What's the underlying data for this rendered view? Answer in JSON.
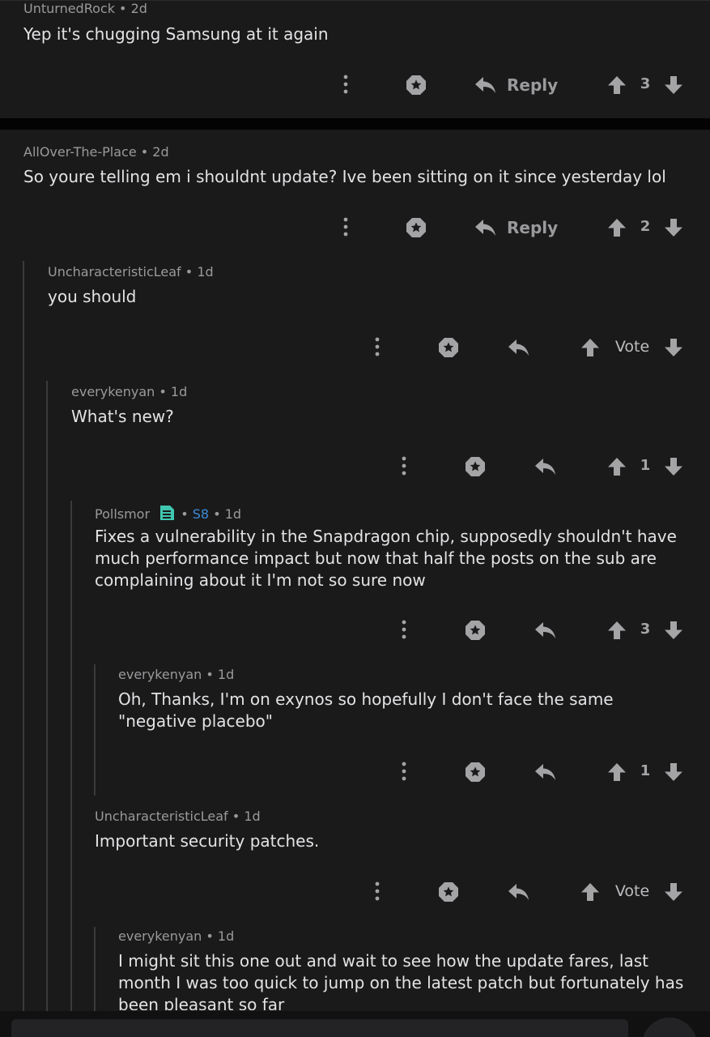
{
  "colors": {
    "background": "#1a1a1b",
    "divider": "#030303",
    "meta_text": "#9a9a9c",
    "body_text": "#e3e3e5",
    "icon": "#a4a4a6",
    "flair": "#3b8bd6",
    "flair_icon": "#3fc7b0",
    "thread_line": "#3a3a3c"
  },
  "comments": [
    {
      "author": "UnturnedRock",
      "age": "2d",
      "text": "Yep it's chugging Samsung at it again",
      "reply_label": "Reply",
      "score": "3"
    },
    {
      "author": "AllOver-The-Place",
      "age": "2d",
      "text": "So youre telling em i shouldnt update? Ive been sitting on it since yesterday lol",
      "reply_label": "Reply",
      "score": "2"
    },
    {
      "author": "UncharacteristicLeaf",
      "age": "1d",
      "text": "you should",
      "score": "Vote"
    },
    {
      "author": "everykenyan",
      "age": "1d",
      "text": "What's new?",
      "score": "1"
    },
    {
      "author": "Pollsmor",
      "flair": "S8",
      "age": "1d",
      "text": "Fixes a vulnerability in the Snapdragon chip, supposedly shouldn't have much performance impact but now that half the posts on the sub are complaining about it I'm not so sure now",
      "score": "3"
    },
    {
      "author": "everykenyan",
      "age": "1d",
      "text": "Oh, Thanks, I'm on exynos so hopefully I don't face the same \"negative placebo\"",
      "score": "1"
    },
    {
      "author": "UncharacteristicLeaf",
      "age": "1d",
      "text": "Important security patches.",
      "score": "Vote"
    },
    {
      "author": "everykenyan",
      "age": "1d",
      "text": "I might sit this one out and wait to see how the update fares, last month I was too quick to jump on the latest patch but fortunately has been pleasant so far"
    }
  ],
  "separator": "•",
  "icons": {
    "more": "more-vertical-icon",
    "award": "award-icon",
    "reply": "reply-arrow-icon",
    "upvote": "upvote-arrow-icon",
    "downvote": "downvote-arrow-icon",
    "flair": "flair-badge-icon"
  }
}
